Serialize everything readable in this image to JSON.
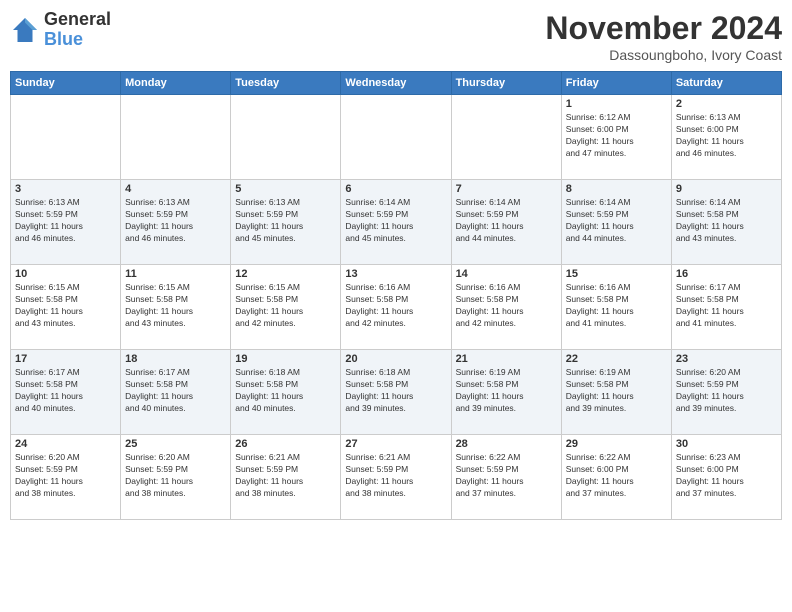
{
  "header": {
    "logo_general": "General",
    "logo_blue": "Blue",
    "month_title": "November 2024",
    "location": "Dassoungboho, Ivory Coast"
  },
  "days_of_week": [
    "Sunday",
    "Monday",
    "Tuesday",
    "Wednesday",
    "Thursday",
    "Friday",
    "Saturday"
  ],
  "weeks": [
    [
      {
        "day": "",
        "info": ""
      },
      {
        "day": "",
        "info": ""
      },
      {
        "day": "",
        "info": ""
      },
      {
        "day": "",
        "info": ""
      },
      {
        "day": "",
        "info": ""
      },
      {
        "day": "1",
        "info": "Sunrise: 6:12 AM\nSunset: 6:00 PM\nDaylight: 11 hours\nand 47 minutes."
      },
      {
        "day": "2",
        "info": "Sunrise: 6:13 AM\nSunset: 6:00 PM\nDaylight: 11 hours\nand 46 minutes."
      }
    ],
    [
      {
        "day": "3",
        "info": "Sunrise: 6:13 AM\nSunset: 5:59 PM\nDaylight: 11 hours\nand 46 minutes."
      },
      {
        "day": "4",
        "info": "Sunrise: 6:13 AM\nSunset: 5:59 PM\nDaylight: 11 hours\nand 46 minutes."
      },
      {
        "day": "5",
        "info": "Sunrise: 6:13 AM\nSunset: 5:59 PM\nDaylight: 11 hours\nand 45 minutes."
      },
      {
        "day": "6",
        "info": "Sunrise: 6:14 AM\nSunset: 5:59 PM\nDaylight: 11 hours\nand 45 minutes."
      },
      {
        "day": "7",
        "info": "Sunrise: 6:14 AM\nSunset: 5:59 PM\nDaylight: 11 hours\nand 44 minutes."
      },
      {
        "day": "8",
        "info": "Sunrise: 6:14 AM\nSunset: 5:59 PM\nDaylight: 11 hours\nand 44 minutes."
      },
      {
        "day": "9",
        "info": "Sunrise: 6:14 AM\nSunset: 5:58 PM\nDaylight: 11 hours\nand 43 minutes."
      }
    ],
    [
      {
        "day": "10",
        "info": "Sunrise: 6:15 AM\nSunset: 5:58 PM\nDaylight: 11 hours\nand 43 minutes."
      },
      {
        "day": "11",
        "info": "Sunrise: 6:15 AM\nSunset: 5:58 PM\nDaylight: 11 hours\nand 43 minutes."
      },
      {
        "day": "12",
        "info": "Sunrise: 6:15 AM\nSunset: 5:58 PM\nDaylight: 11 hours\nand 42 minutes."
      },
      {
        "day": "13",
        "info": "Sunrise: 6:16 AM\nSunset: 5:58 PM\nDaylight: 11 hours\nand 42 minutes."
      },
      {
        "day": "14",
        "info": "Sunrise: 6:16 AM\nSunset: 5:58 PM\nDaylight: 11 hours\nand 42 minutes."
      },
      {
        "day": "15",
        "info": "Sunrise: 6:16 AM\nSunset: 5:58 PM\nDaylight: 11 hours\nand 41 minutes."
      },
      {
        "day": "16",
        "info": "Sunrise: 6:17 AM\nSunset: 5:58 PM\nDaylight: 11 hours\nand 41 minutes."
      }
    ],
    [
      {
        "day": "17",
        "info": "Sunrise: 6:17 AM\nSunset: 5:58 PM\nDaylight: 11 hours\nand 40 minutes."
      },
      {
        "day": "18",
        "info": "Sunrise: 6:17 AM\nSunset: 5:58 PM\nDaylight: 11 hours\nand 40 minutes."
      },
      {
        "day": "19",
        "info": "Sunrise: 6:18 AM\nSunset: 5:58 PM\nDaylight: 11 hours\nand 40 minutes."
      },
      {
        "day": "20",
        "info": "Sunrise: 6:18 AM\nSunset: 5:58 PM\nDaylight: 11 hours\nand 39 minutes."
      },
      {
        "day": "21",
        "info": "Sunrise: 6:19 AM\nSunset: 5:58 PM\nDaylight: 11 hours\nand 39 minutes."
      },
      {
        "day": "22",
        "info": "Sunrise: 6:19 AM\nSunset: 5:58 PM\nDaylight: 11 hours\nand 39 minutes."
      },
      {
        "day": "23",
        "info": "Sunrise: 6:20 AM\nSunset: 5:59 PM\nDaylight: 11 hours\nand 39 minutes."
      }
    ],
    [
      {
        "day": "24",
        "info": "Sunrise: 6:20 AM\nSunset: 5:59 PM\nDaylight: 11 hours\nand 38 minutes."
      },
      {
        "day": "25",
        "info": "Sunrise: 6:20 AM\nSunset: 5:59 PM\nDaylight: 11 hours\nand 38 minutes."
      },
      {
        "day": "26",
        "info": "Sunrise: 6:21 AM\nSunset: 5:59 PM\nDaylight: 11 hours\nand 38 minutes."
      },
      {
        "day": "27",
        "info": "Sunrise: 6:21 AM\nSunset: 5:59 PM\nDaylight: 11 hours\nand 38 minutes."
      },
      {
        "day": "28",
        "info": "Sunrise: 6:22 AM\nSunset: 5:59 PM\nDaylight: 11 hours\nand 37 minutes."
      },
      {
        "day": "29",
        "info": "Sunrise: 6:22 AM\nSunset: 6:00 PM\nDaylight: 11 hours\nand 37 minutes."
      },
      {
        "day": "30",
        "info": "Sunrise: 6:23 AM\nSunset: 6:00 PM\nDaylight: 11 hours\nand 37 minutes."
      }
    ]
  ]
}
